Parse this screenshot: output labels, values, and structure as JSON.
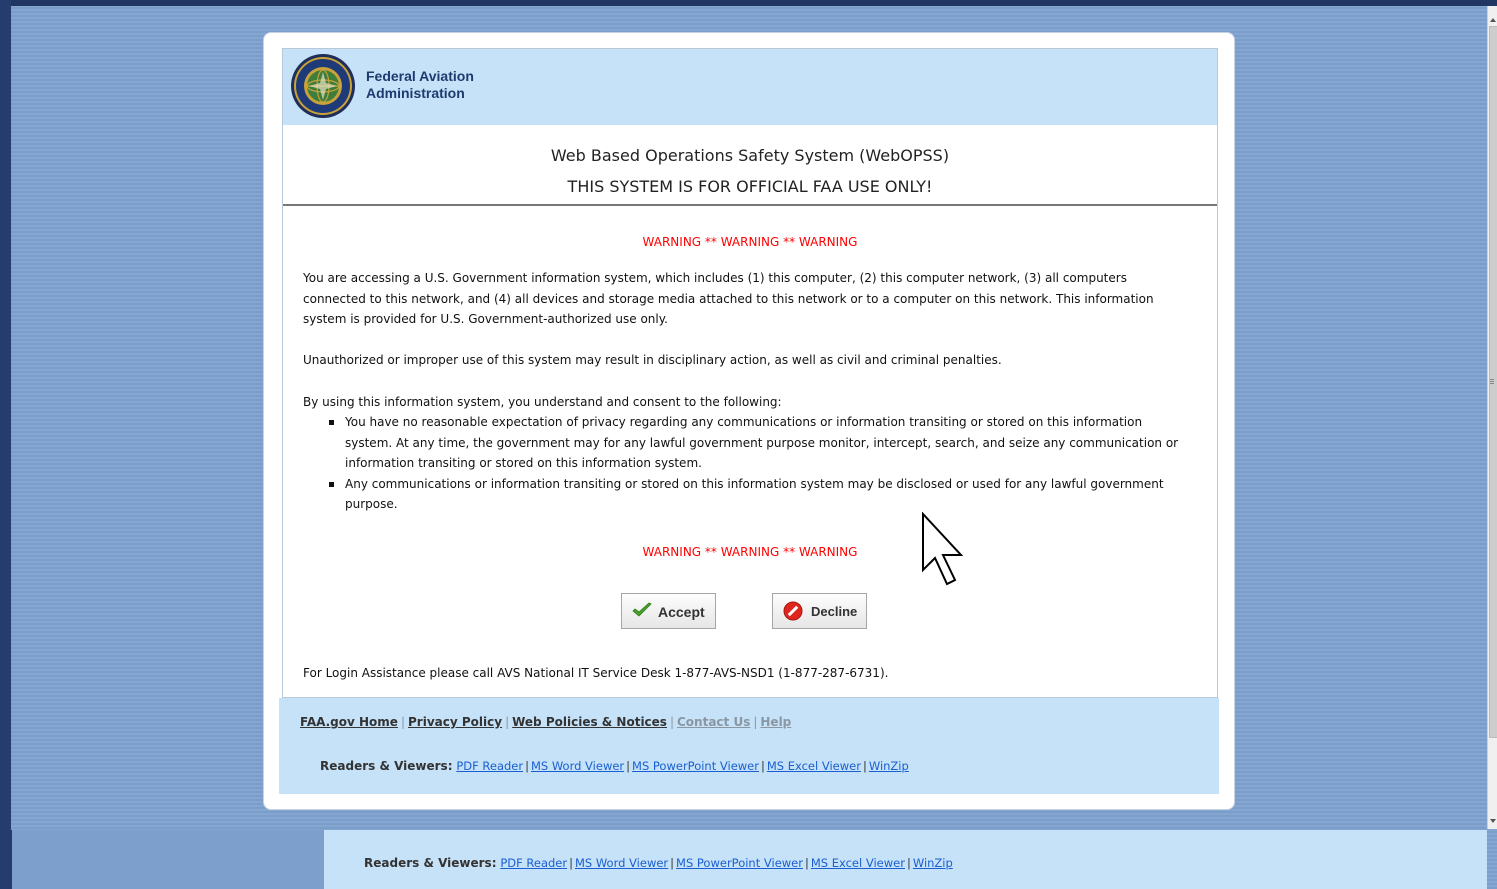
{
  "header": {
    "agency_line1": "Federal Aviation",
    "agency_line2": "Administration",
    "seal_icon": "faa-seal-icon"
  },
  "titles": {
    "system_name": "Web Based Operations Safety System (WebOPSS)",
    "official_use": "THIS SYSTEM IS FOR OFFICIAL FAA USE ONLY!"
  },
  "warning": {
    "top": "WARNING ** WARNING ** WARNING",
    "bottom": "WARNING ** WARNING ** WARNING",
    "color": "#ff0000"
  },
  "body": {
    "para1": "You are accessing a U.S. Government information system, which includes (1) this computer, (2) this computer network, (3) all computers connected to this network, and (4) all devices and storage media attached to this network or to a computer on this network. This information system is provided for U.S. Government-authorized use only.",
    "para2": "Unauthorized or improper use of this system may result in disciplinary action, as well as civil and criminal penalties.",
    "para3": "By using this information system, you understand and consent to the following:",
    "bullets": [
      "You have no reasonable expectation of privacy regarding any communications or information transiting or stored on this information system. At any time, the government may for any lawful government purpose monitor, intercept, search, and seize any communication or information transiting or stored on this information system.",
      "Any communications or information transiting or stored on this information system may be disclosed or used for any lawful government purpose."
    ]
  },
  "buttons": {
    "accept_label": "Accept",
    "decline_label": "Decline",
    "accept_icon": "checkmark-icon",
    "decline_icon": "no-entry-icon"
  },
  "assistance": "For Login Assistance please call AVS National IT Service Desk 1-877-AVS-NSD1 (1-877-287-6731).",
  "footer": {
    "links": [
      "FAA.gov Home",
      "Privacy Policy",
      "Web Policies & Notices",
      "Contact Us",
      "Help"
    ],
    "readers_label": "Readers & Viewers:",
    "readers": [
      "PDF Reader",
      "MS Word Viewer",
      "MS PowerPoint Viewer",
      "MS Excel Viewer",
      "WinZip"
    ]
  },
  "colors": {
    "background": "#7d9fcc",
    "header_band": "#c6e2f8",
    "link_blue": "#1a5fd0"
  }
}
